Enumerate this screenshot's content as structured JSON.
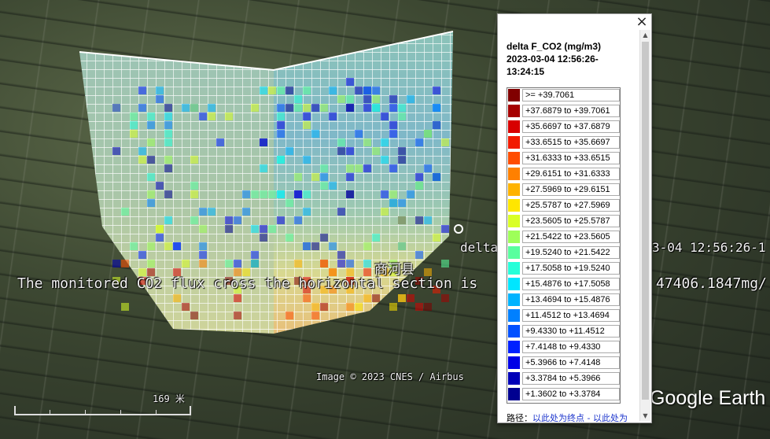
{
  "map": {
    "place_label": "商河县",
    "attribution": "Image © 2023 CNES / Airbus",
    "scale_label": "169 米",
    "brand": "Google Earth",
    "data_label_partial": "delta",
    "data_time_partial": "3-04 12:56:26-1",
    "flux_text": "The monitored CO2 flux cross the horizontal section is",
    "flux_value_partial": "47406.1847mg/"
  },
  "legend": {
    "title": "delta F_CO2 (mg/m3) 2023-03-04 12:56:26-13:24:15",
    "close_label": "×",
    "footer_prefix": "路径：",
    "footer_link": "以此处为终点 - 以此处为",
    "rows": [
      {
        "label": ">= +39.7061",
        "color": "#800000"
      },
      {
        "label": "+37.6879 to +39.7061",
        "color": "#a60000"
      },
      {
        "label": "+35.6697 to +37.6879",
        "color": "#d80000"
      },
      {
        "label": "+33.6515 to +35.6697",
        "color": "#f21a00"
      },
      {
        "label": "+31.6333 to +33.6515",
        "color": "#ff4d00"
      },
      {
        "label": "+29.6151 to +31.6333",
        "color": "#ff8000"
      },
      {
        "label": "+27.5969 to +29.6151",
        "color": "#ffb300"
      },
      {
        "label": "+25.5787 to +27.5969",
        "color": "#ffe600"
      },
      {
        "label": "+23.5605 to +25.5787",
        "color": "#d9ff26"
      },
      {
        "label": "+21.5422 to +23.5605",
        "color": "#9eff59"
      },
      {
        "label": "+19.5240 to +21.5422",
        "color": "#59ff9e"
      },
      {
        "label": "+17.5058 to +19.5240",
        "color": "#26ffd9"
      },
      {
        "label": "+15.4876 to +17.5058",
        "color": "#00e6ff"
      },
      {
        "label": "+13.4694 to +15.4876",
        "color": "#00b3ff"
      },
      {
        "label": "+11.4512 to +13.4694",
        "color": "#0080ff"
      },
      {
        "label": "+9.4330 to +11.4512",
        "color": "#0050ff"
      },
      {
        "label": "+7.4148 to +9.4330",
        "color": "#0020ff"
      },
      {
        "label": "+5.3966 to +7.4148",
        "color": "#0000e6"
      },
      {
        "label": "+3.3784 to +5.3966",
        "color": "#0000b8"
      },
      {
        "label": "+1.3602 to +3.3784",
        "color": "#000090"
      }
    ]
  }
}
